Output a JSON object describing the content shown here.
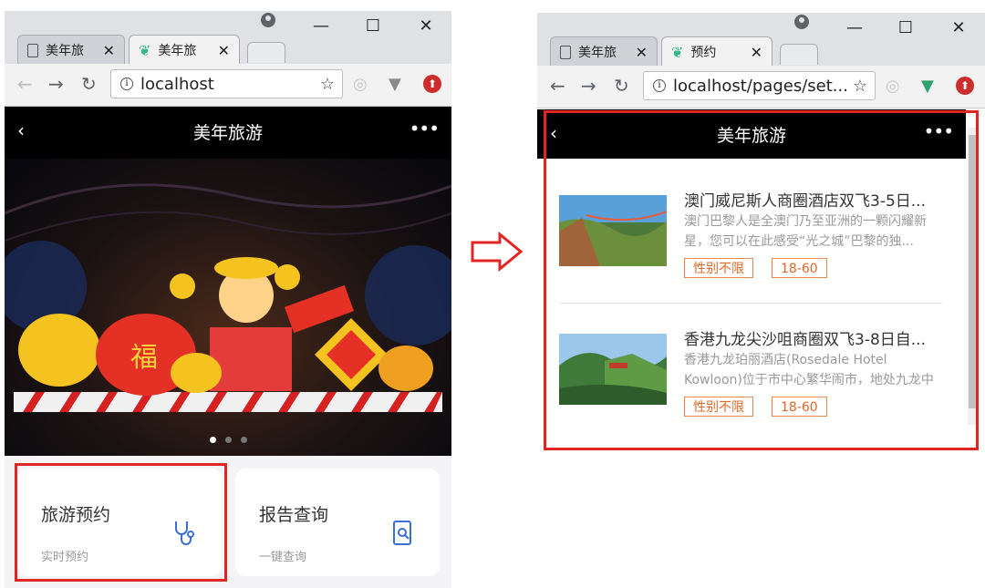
{
  "left_window": {
    "tabs": [
      {
        "title": "美年旅",
        "active": false
      },
      {
        "title": "美年旅",
        "active": true
      }
    ],
    "url": "localhost",
    "app": {
      "title": "美年旅游",
      "carousel": {
        "dots": 3,
        "active": 0
      },
      "cards": [
        {
          "title": "旅游预约",
          "subtitle": "实时预约",
          "icon": "stethoscope-icon"
        },
        {
          "title": "报告查询",
          "subtitle": "一键查询",
          "icon": "report-search-icon"
        }
      ]
    }
  },
  "right_window": {
    "tabs": [
      {
        "title": "美年旅",
        "active": false
      },
      {
        "title": "预约",
        "active": true
      }
    ],
    "url": "localhost/pages/set...",
    "app": {
      "title": "美年旅游",
      "items": [
        {
          "title": "澳门威尼斯人商圈酒店双飞3-5日...",
          "desc": "澳门巴黎人是全澳门乃至亚洲的一颗闪耀新星，您可以在此感受“光之城”巴黎的独...",
          "tags": [
            "性别不限",
            "18-60"
          ]
        },
        {
          "title": "香港九龙尖沙咀商圈双飞3-8日自...",
          "desc": "香港九龙珀丽酒店(Rosedale Hotel Kowloon)位于市中心繁华闹市，地处九龙中心...",
          "tags": [
            "性别不限",
            "18-60"
          ]
        }
      ]
    }
  },
  "colors": {
    "highlight": "#e02525",
    "tag": "#e06a2b",
    "accent": "#3b6fd6"
  }
}
